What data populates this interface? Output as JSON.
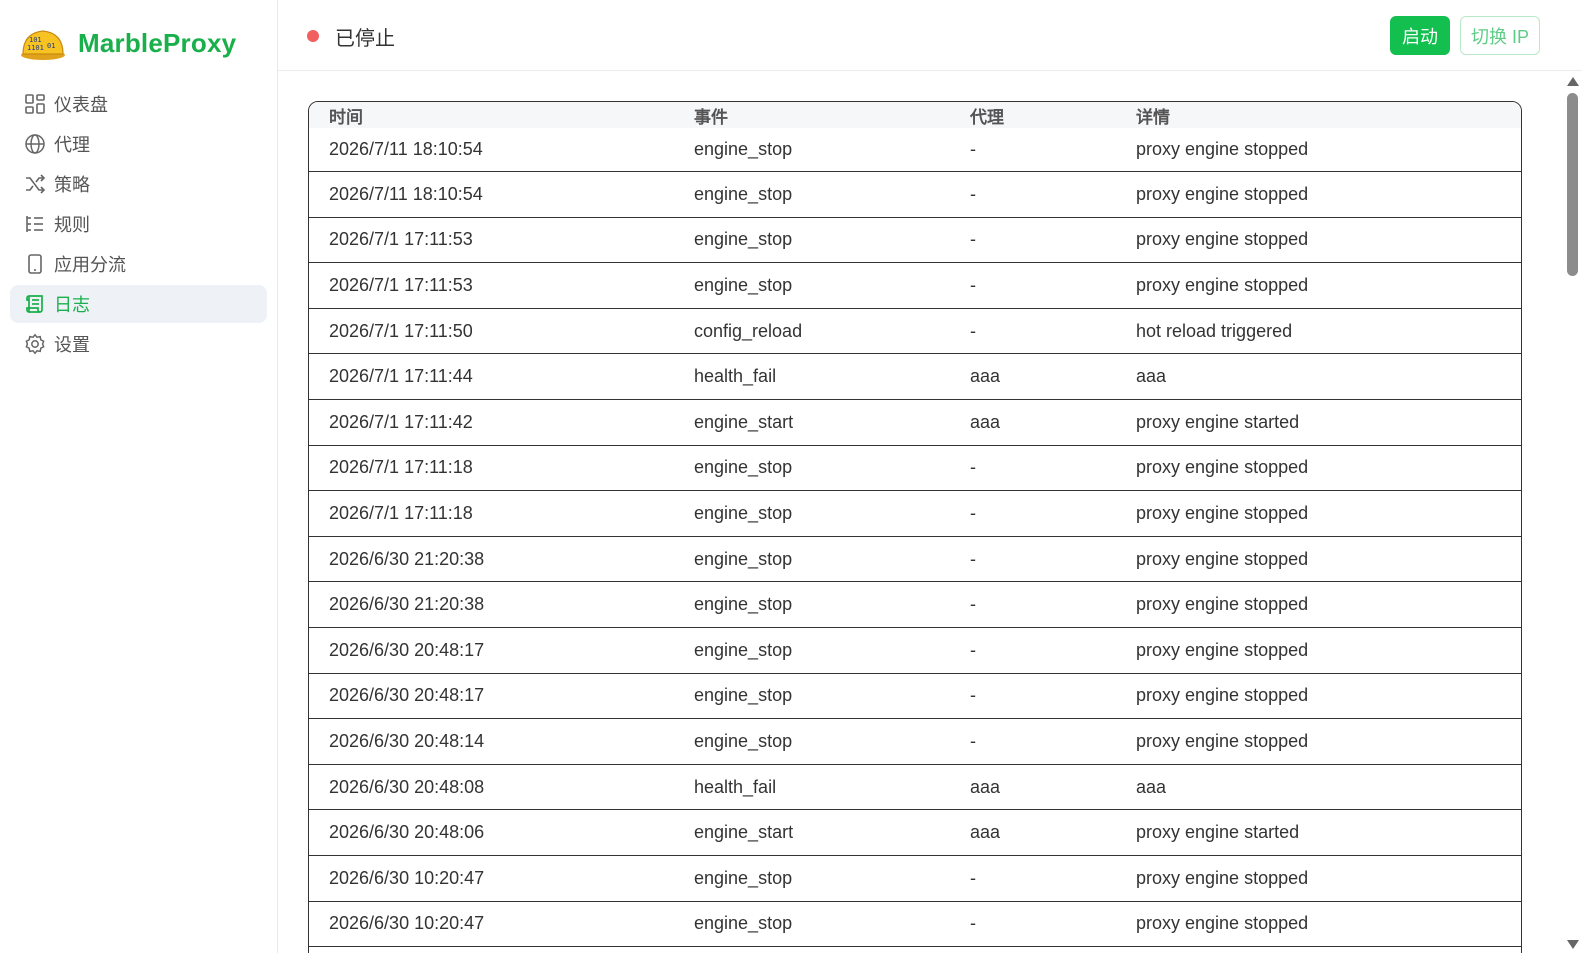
{
  "brand": {
    "name": "MarbleProxy",
    "logo_icon": "marble-binary-logo"
  },
  "nav": {
    "items": [
      {
        "label": "仪表盘",
        "icon": "dashboard-grid-icon"
      },
      {
        "label": "代理",
        "icon": "globe-icon"
      },
      {
        "label": "策略",
        "icon": "shuffle-icon"
      },
      {
        "label": "规则",
        "icon": "list-icon"
      },
      {
        "label": "应用分流",
        "icon": "mobile-icon"
      },
      {
        "label": "日志",
        "icon": "scroll-log-icon",
        "active": true
      },
      {
        "label": "设置",
        "icon": "gear-icon"
      }
    ]
  },
  "status": {
    "text": "已停止",
    "color": "#f25f5f"
  },
  "actions": {
    "start_label": "启动",
    "switch_ip_label": "切换 IP"
  },
  "colors": {
    "accent": "#19b04b",
    "start_button": "#12bf4f"
  },
  "log_table": {
    "columns": [
      "时间",
      "事件",
      "代理",
      "详情"
    ],
    "rows": [
      [
        "2026/7/11 18:10:54",
        "engine_stop",
        "-",
        "proxy engine stopped"
      ],
      [
        "2026/7/11 18:10:54",
        "engine_stop",
        "-",
        "proxy engine stopped"
      ],
      [
        "2026/7/1 17:11:53",
        "engine_stop",
        "-",
        "proxy engine stopped"
      ],
      [
        "2026/7/1 17:11:53",
        "engine_stop",
        "-",
        "proxy engine stopped"
      ],
      [
        "2026/7/1 17:11:50",
        "config_reload",
        "-",
        "hot reload triggered"
      ],
      [
        "2026/7/1 17:11:44",
        "health_fail",
        "aaa",
        "aaa"
      ],
      [
        "2026/7/1 17:11:42",
        "engine_start",
        "aaa",
        "proxy engine started"
      ],
      [
        "2026/7/1 17:11:18",
        "engine_stop",
        "-",
        "proxy engine stopped"
      ],
      [
        "2026/7/1 17:11:18",
        "engine_stop",
        "-",
        "proxy engine stopped"
      ],
      [
        "2026/6/30 21:20:38",
        "engine_stop",
        "-",
        "proxy engine stopped"
      ],
      [
        "2026/6/30 21:20:38",
        "engine_stop",
        "-",
        "proxy engine stopped"
      ],
      [
        "2026/6/30 20:48:17",
        "engine_stop",
        "-",
        "proxy engine stopped"
      ],
      [
        "2026/6/30 20:48:17",
        "engine_stop",
        "-",
        "proxy engine stopped"
      ],
      [
        "2026/6/30 20:48:14",
        "engine_stop",
        "-",
        "proxy engine stopped"
      ],
      [
        "2026/6/30 20:48:08",
        "health_fail",
        "aaa",
        "aaa"
      ],
      [
        "2026/6/30 20:48:06",
        "engine_start",
        "aaa",
        "proxy engine started"
      ],
      [
        "2026/6/30 10:20:47",
        "engine_stop",
        "-",
        "proxy engine stopped"
      ],
      [
        "2026/6/30 10:20:47",
        "engine_stop",
        "-",
        "proxy engine stopped"
      ]
    ]
  }
}
